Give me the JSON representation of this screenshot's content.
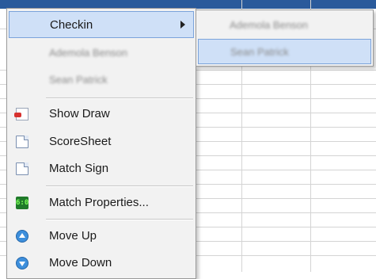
{
  "menu": {
    "checkin_label": "Checkin",
    "players": [
      "Ademola Benson",
      "Sean Patrick"
    ],
    "show_draw_label": "Show Draw",
    "scoresheet_label": "ScoreSheet",
    "match_sign_label": "Match Sign",
    "match_properties_label": "Match Properties...",
    "match_properties_icon_text": "6:0",
    "move_up_label": "Move Up",
    "move_down_label": "Move Down"
  },
  "submenu": {
    "items": [
      "Ademola Benson",
      "Sean Patrick"
    ],
    "highlighted_index": 1
  },
  "icons": {
    "show_draw": "draw-icon",
    "scoresheet": "document-icon",
    "match_sign": "document-icon",
    "match_properties": "scoreboard-icon",
    "move_up": "arrow-up-circle-icon",
    "move_down": "arrow-down-circle-icon"
  },
  "colors": {
    "highlight": "#cfe0f7",
    "highlight_border": "#7ba3db",
    "menu_bg": "#f2f2f2",
    "header_bar": "#2a5a9b"
  }
}
